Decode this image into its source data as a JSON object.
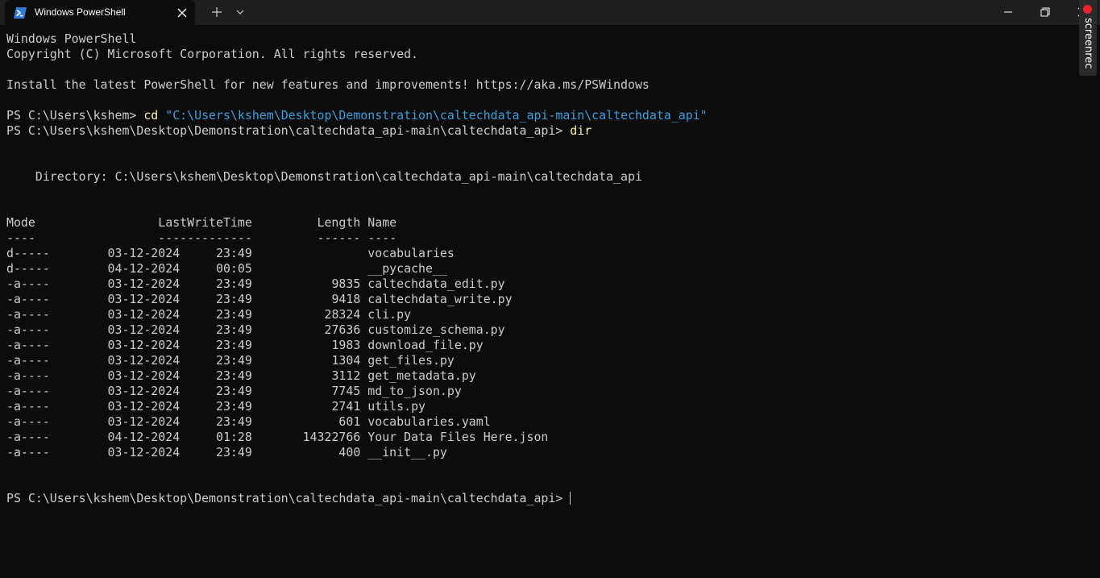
{
  "window": {
    "tab_title": "Windows PowerShell",
    "tab_icon": "powershell-icon",
    "controls": [
      "minimize-icon",
      "maximize-icon",
      "close-icon"
    ]
  },
  "overlay": {
    "screenrec_label": "screenrec",
    "record_color": "#e8262a"
  },
  "colors": {
    "background": "#0c0c0c",
    "text": "#cccccc",
    "command": "#f9f1a5",
    "string": "#3b9fdf"
  },
  "terminal": {
    "banner": [
      "Windows PowerShell",
      "Copyright (C) Microsoft Corporation. All rights reserved.",
      "",
      "Install the latest PowerShell for new features and improvements! https://aka.ms/PSWindows"
    ],
    "prompt1": "PS C:\\Users\\kshem> ",
    "cmd1": "cd",
    "cmd1_arg": "\"C:\\Users\\kshem\\Desktop\\Demonstration\\caltechdata_api-main\\caltechdata_api\"",
    "prompt2": "PS C:\\Users\\kshem\\Desktop\\Demonstration\\caltechdata_api-main\\caltechdata_api> ",
    "cmd2": "dir",
    "directory_line": "    Directory: C:\\Users\\kshem\\Desktop\\Demonstration\\caltechdata_api-main\\caltechdata_api",
    "headers": [
      "Mode",
      "LastWriteTime",
      "Length",
      "Name"
    ],
    "header_underlines": [
      "----",
      "-------------",
      "------",
      "----"
    ],
    "rows": [
      {
        "mode": "d-----",
        "date": "03-12-2024",
        "time": "23:49",
        "length": "",
        "name": "vocabularies"
      },
      {
        "mode": "d-----",
        "date": "04-12-2024",
        "time": "00:05",
        "length": "",
        "name": "__pycache__"
      },
      {
        "mode": "-a----",
        "date": "03-12-2024",
        "time": "23:49",
        "length": "9835",
        "name": "caltechdata_edit.py"
      },
      {
        "mode": "-a----",
        "date": "03-12-2024",
        "time": "23:49",
        "length": "9418",
        "name": "caltechdata_write.py"
      },
      {
        "mode": "-a----",
        "date": "03-12-2024",
        "time": "23:49",
        "length": "28324",
        "name": "cli.py"
      },
      {
        "mode": "-a----",
        "date": "03-12-2024",
        "time": "23:49",
        "length": "27636",
        "name": "customize_schema.py"
      },
      {
        "mode": "-a----",
        "date": "03-12-2024",
        "time": "23:49",
        "length": "1983",
        "name": "download_file.py"
      },
      {
        "mode": "-a----",
        "date": "03-12-2024",
        "time": "23:49",
        "length": "1304",
        "name": "get_files.py"
      },
      {
        "mode": "-a----",
        "date": "03-12-2024",
        "time": "23:49",
        "length": "3112",
        "name": "get_metadata.py"
      },
      {
        "mode": "-a----",
        "date": "03-12-2024",
        "time": "23:49",
        "length": "7745",
        "name": "md_to_json.py"
      },
      {
        "mode": "-a----",
        "date": "03-12-2024",
        "time": "23:49",
        "length": "2741",
        "name": "utils.py"
      },
      {
        "mode": "-a----",
        "date": "03-12-2024",
        "time": "23:49",
        "length": "601",
        "name": "vocabularies.yaml"
      },
      {
        "mode": "-a----",
        "date": "04-12-2024",
        "time": "01:28",
        "length": "14322766",
        "name": "Your Data Files Here.json"
      },
      {
        "mode": "-a----",
        "date": "03-12-2024",
        "time": "23:49",
        "length": "400",
        "name": "__init__.py"
      }
    ],
    "final_prompt": "PS C:\\Users\\kshem\\Desktop\\Demonstration\\caltechdata_api-main\\caltechdata_api> "
  }
}
